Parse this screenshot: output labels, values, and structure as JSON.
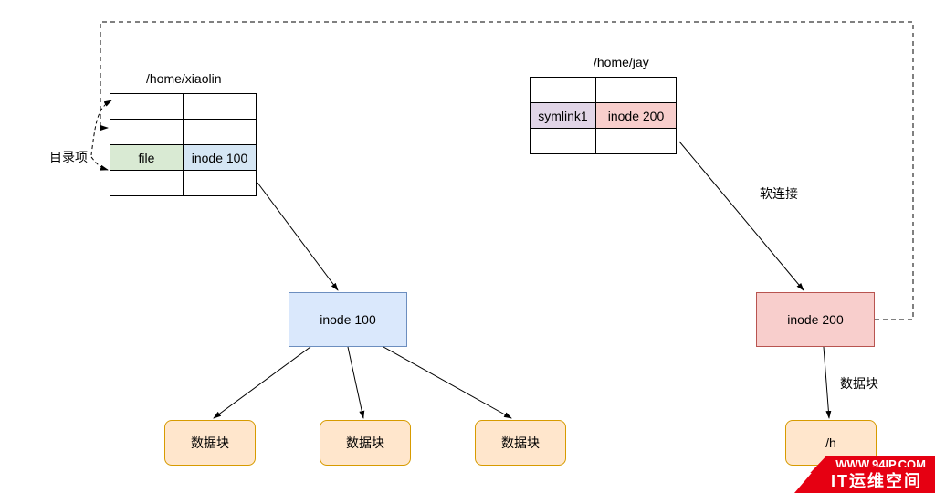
{
  "diagram": {
    "left": {
      "title": "/home/xiaolin",
      "dir_label": "目录项",
      "rows": [
        {
          "name": "",
          "inode": ""
        },
        {
          "name": "",
          "inode": ""
        },
        {
          "name": "file",
          "inode": "inode 100"
        },
        {
          "name": "",
          "inode": ""
        }
      ],
      "inode_box": "inode 100",
      "datablocks": [
        "数据块",
        "数据块",
        "数据块"
      ]
    },
    "right": {
      "title": "/home/jay",
      "rows": [
        {
          "name": "",
          "inode": ""
        },
        {
          "name": "symlink1",
          "inode": "inode 200"
        },
        {
          "name": "",
          "inode": ""
        }
      ],
      "softlink_label": "软连接",
      "inode_box": "inode 200",
      "datablock_label": "数据块",
      "datablocks": [
        "/h"
      ]
    }
  },
  "watermark": {
    "url": "WWW.94IP.COM",
    "brand": "IT运维空间"
  }
}
